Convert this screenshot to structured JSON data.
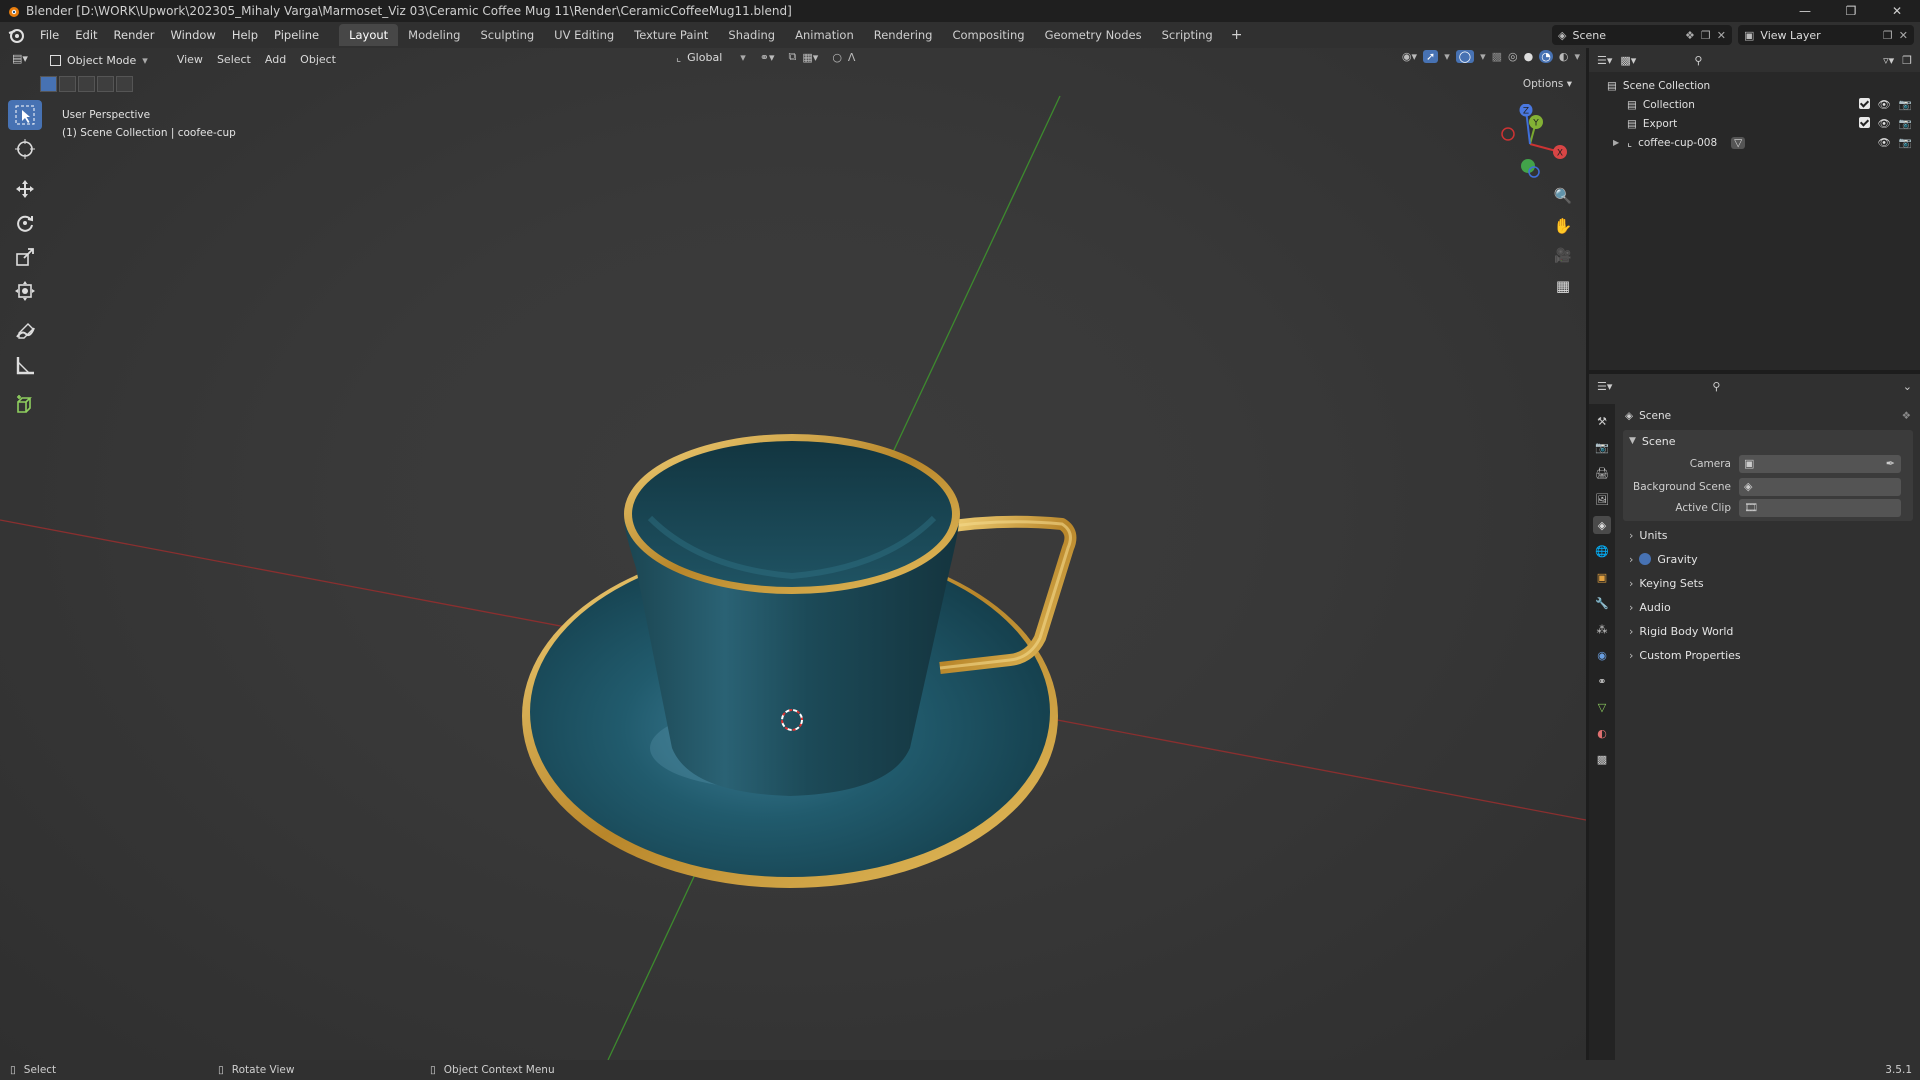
{
  "window": {
    "title": "Blender [D:\\WORK\\Upwork\\202305_Mihaly Varga\\Marmoset_Viz 03\\Ceramic Coffee Mug 11\\Render\\CeramicCoffeeMug11.blend]"
  },
  "menu": [
    "File",
    "Edit",
    "Render",
    "Window",
    "Help",
    "Pipeline"
  ],
  "workspaces": [
    "Layout",
    "Modeling",
    "Sculpting",
    "UV Editing",
    "Texture Paint",
    "Shading",
    "Animation",
    "Rendering",
    "Compositing",
    "Geometry Nodes",
    "Scripting"
  ],
  "active_workspace": "Layout",
  "scene_name": "Scene",
  "view_layer": "View Layer",
  "viewport": {
    "mode": "Object Mode",
    "menus": [
      "View",
      "Select",
      "Add",
      "Object"
    ],
    "orientation": "Global",
    "options_label": "Options",
    "perspective_label": "User Perspective",
    "collection_label": "(1) Scene Collection | coofee-cup",
    "gizmo_axes": [
      "X",
      "Y",
      "Z"
    ]
  },
  "outliner": {
    "root": "Scene Collection",
    "items": [
      {
        "name": "Collection"
      },
      {
        "name": "Export"
      },
      {
        "name": "coffee-cup-008"
      }
    ]
  },
  "properties": {
    "context": "Scene",
    "panel_title": "Scene",
    "fields": [
      {
        "label": "Camera"
      },
      {
        "label": "Background Scene"
      },
      {
        "label": "Active Clip"
      }
    ],
    "subpanels": [
      "Units",
      "Gravity",
      "Keying Sets",
      "Audio",
      "Rigid Body World",
      "Custom Properties"
    ]
  },
  "status": {
    "select": "Select",
    "rotate": "Rotate View",
    "context_menu": "Object Context Menu",
    "version": "3.5.1"
  },
  "colors": {
    "accent": "#4772b3",
    "cup_teal": "#1d4f5c",
    "gold": "#c9a136",
    "x_axis": "#b33a3a",
    "y_axis": "#3a8f2a"
  }
}
